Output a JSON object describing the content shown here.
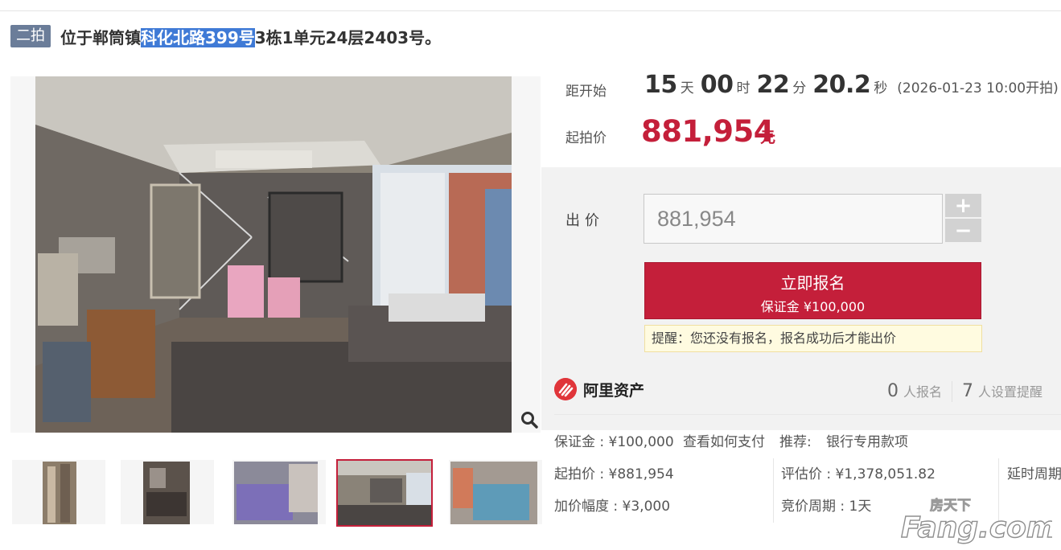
{
  "header": {
    "tag": "二拍",
    "title_before": "位于郸筒镇",
    "title_highlight": "科化北路399号",
    "title_after": "3栋1单元24层2403号。"
  },
  "countdown": {
    "label": "距开始",
    "days": "15",
    "days_unit": "天",
    "hours": "00",
    "hours_unit": "时",
    "minutes": "22",
    "minutes_unit": "分",
    "seconds": "20.2",
    "seconds_unit": "秒",
    "start_text": "(2026-01-23 10:00开拍)"
  },
  "start_price": {
    "label": "起拍价",
    "value": "881,954",
    "unit": "元"
  },
  "bid": {
    "label": "出价",
    "value": "881,954",
    "plus": "+",
    "minus": "−",
    "signup_label": "立即报名",
    "deposit_label": "保证金 ¥100,000",
    "reminder": "提醒：您还没有报名，报名成功后才能出价"
  },
  "platform": {
    "name": "阿里资产",
    "signups_num": "0",
    "signups_text": "人报名",
    "reminders_num": "7",
    "reminders_text": "人设置提醒"
  },
  "info": {
    "deposit": "保证金 : ¥100,000",
    "pay_link": "查看如何支付",
    "recommend_label": "推荐:",
    "recommend_link": "银行专用款项",
    "start_price": "起拍价 : ¥881,954",
    "eval_price": "评估价 : ¥1,378,051.82",
    "delay": "延时周期",
    "increment": "加价幅度 : ¥3,000",
    "cycle": "竞价周期 : 1天"
  },
  "watermark": {
    "cn": "房天下",
    "en": "Fang.com"
  },
  "colors": {
    "accent_red": "#c41f3a",
    "link_blue": "#3d73c6",
    "tag_bg": "#6b7d99",
    "highlight_bg": "#3f7ad6"
  }
}
